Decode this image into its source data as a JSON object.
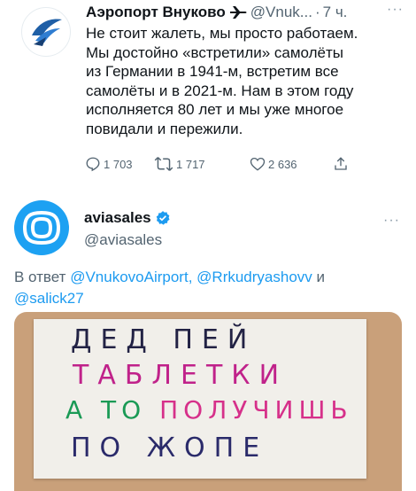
{
  "tweet1": {
    "author_name": "Аэропорт Внуково",
    "author_handle": "@Vnuk...",
    "separator": "·",
    "time": "7 ч.",
    "more": "···",
    "text_lines": [
      "Не стоит жалеть, мы просто работаем.",
      "Мы достойно «встретили» самолёты",
      "из Германии в 1941-м, встретим все",
      "самолёты и в 2021-м. Нам в этом году",
      "исполняется 80 лет и мы уже многое",
      "повидали и пережили."
    ],
    "replies": "1 703",
    "retweets": "1 717",
    "likes": "2 636",
    "icons": [
      "airplane-emoji-icon",
      "reply-icon",
      "retweet-icon",
      "like-icon",
      "share-icon"
    ]
  },
  "tweet2": {
    "author_name": "aviasales",
    "author_handle": "@aviasales",
    "more": "···",
    "reply_prefix": "В ответ",
    "mention1": "@VnukovoAirport",
    "comma": ",",
    "mention2": "@Rrkudryashovv",
    "and_word": "и",
    "mention3": "@salick27",
    "icons": [
      "verified-badge-icon",
      "aviasales-logo-icon"
    ]
  },
  "photo": {
    "lines": [
      {
        "text": "ДЕД ПЕЙ",
        "color": "#222244"
      },
      {
        "text": "ТАБЛЕТКИ",
        "color": "#c0228a"
      },
      {
        "text": "А ТО ПОЛУЧИШЬ",
        "color": "#1a9a55",
        "highlight": "ПОЛУЧИШЬ",
        "highlight_color": "#d6308a"
      },
      {
        "text": "ПО ЖОПЕ",
        "color": "#2a2a6a"
      }
    ]
  },
  "colors": {
    "link": "#1d9bf0",
    "secondary": "#536471",
    "aviasales_blue": "#1da1f2"
  }
}
